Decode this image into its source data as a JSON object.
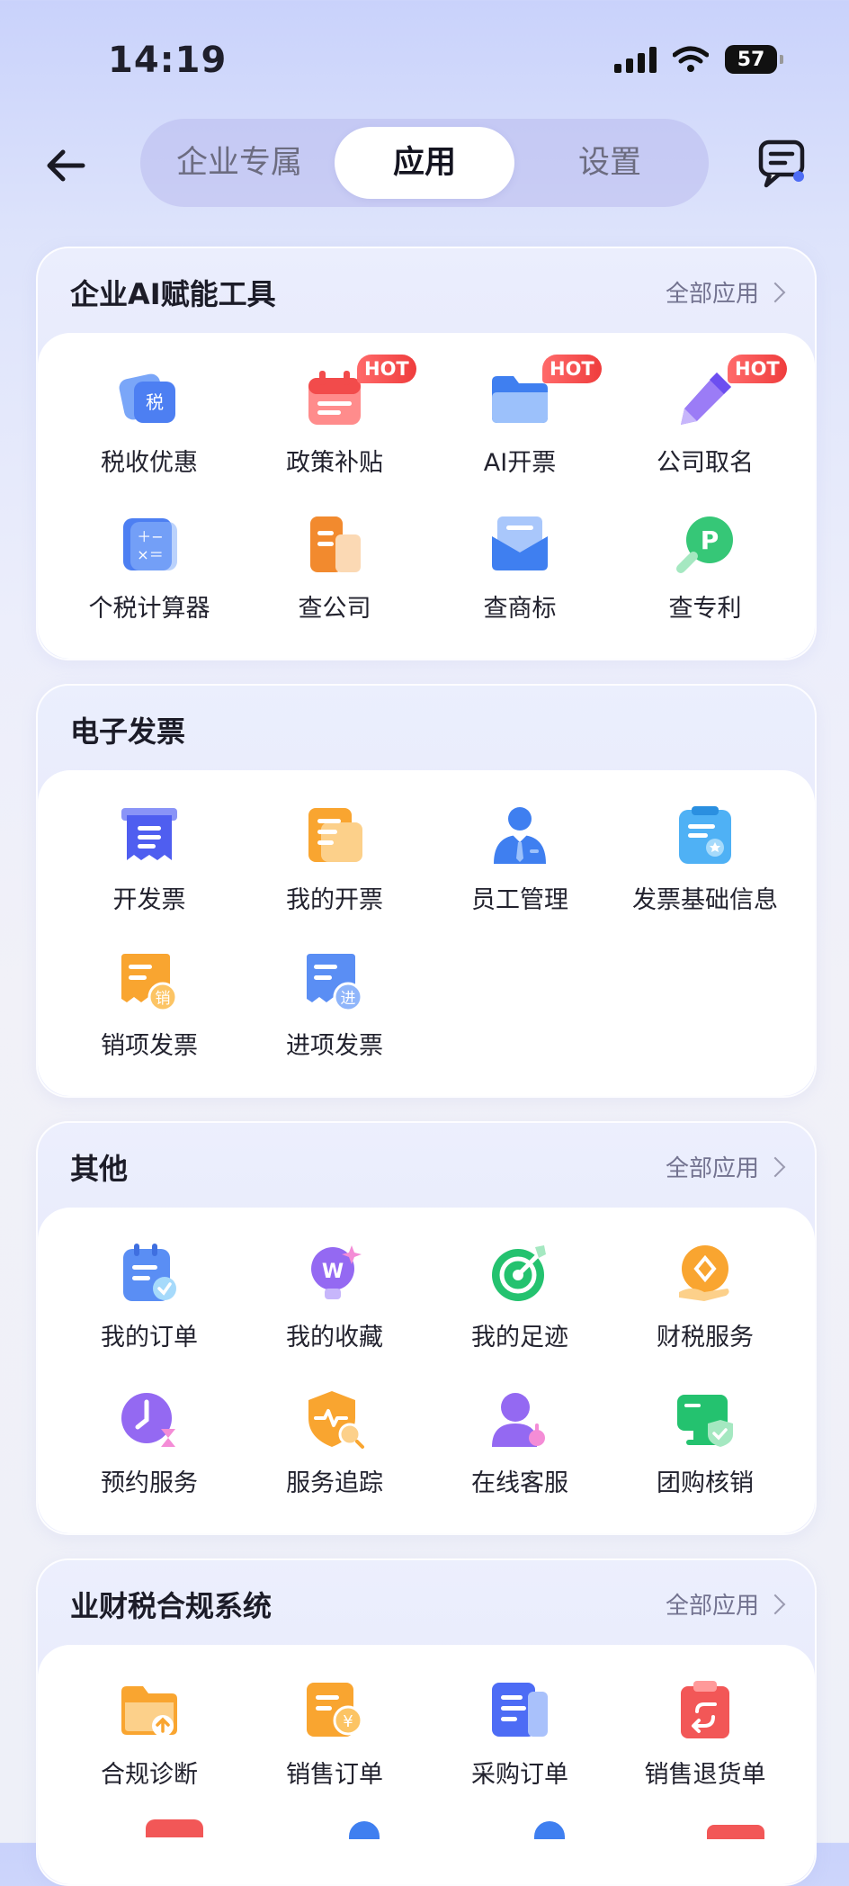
{
  "status_bar": {
    "time": "14:19",
    "battery": "57"
  },
  "nav": {
    "tabs": [
      {
        "label": "企业专属",
        "active": false
      },
      {
        "label": "应用",
        "active": true
      },
      {
        "label": "设置",
        "active": false
      }
    ]
  },
  "colors": {
    "accent": "#4d6cf5",
    "hot": "#ef3d3d"
  },
  "sections": [
    {
      "title": "企业AI赋能工具",
      "more": "全部应用",
      "items": [
        {
          "label": "税收优惠",
          "icon": "tax-icon",
          "badge": ""
        },
        {
          "label": "政策补贴",
          "icon": "calendar-icon",
          "badge": "HOT"
        },
        {
          "label": "AI开票",
          "icon": "folder-icon",
          "badge": "HOT"
        },
        {
          "label": "公司取名",
          "icon": "pen-icon",
          "badge": "HOT"
        },
        {
          "label": "个税计算器",
          "icon": "calculator-icon",
          "badge": ""
        },
        {
          "label": "查公司",
          "icon": "building-icon",
          "badge": ""
        },
        {
          "label": "查商标",
          "icon": "mail-icon",
          "badge": ""
        },
        {
          "label": "查专利",
          "icon": "patent-search-icon",
          "badge": ""
        }
      ]
    },
    {
      "title": "电子发票",
      "more": "",
      "items": [
        {
          "label": "开发票",
          "icon": "invoice-icon"
        },
        {
          "label": "我的开票",
          "icon": "scroll-icon"
        },
        {
          "label": "员工管理",
          "icon": "employee-icon"
        },
        {
          "label": "发票基础信息",
          "icon": "clipboard-icon"
        },
        {
          "label": "销项发票",
          "icon": "sales-invoice-icon"
        },
        {
          "label": "进项发票",
          "icon": "input-invoice-icon"
        }
      ]
    },
    {
      "title": "其他",
      "more": "全部应用",
      "items": [
        {
          "label": "我的订单",
          "icon": "order-icon"
        },
        {
          "label": "我的收藏",
          "icon": "favorite-icon"
        },
        {
          "label": "我的足迹",
          "icon": "target-icon"
        },
        {
          "label": "财税服务",
          "icon": "finance-service-icon"
        },
        {
          "label": "预约服务",
          "icon": "clock-icon"
        },
        {
          "label": "服务追踪",
          "icon": "shield-search-icon"
        },
        {
          "label": "在线客服",
          "icon": "agent-icon"
        },
        {
          "label": "团购核销",
          "icon": "monitor-check-icon"
        }
      ]
    },
    {
      "title": "业财税合规系统",
      "more": "全部应用",
      "items": [
        {
          "label": "合规诊断",
          "icon": "folder-upload-icon"
        },
        {
          "label": "销售订单",
          "icon": "sales-order-icon"
        },
        {
          "label": "采购订单",
          "icon": "purchase-order-icon"
        },
        {
          "label": "销售退货单",
          "icon": "return-order-icon"
        }
      ]
    }
  ]
}
